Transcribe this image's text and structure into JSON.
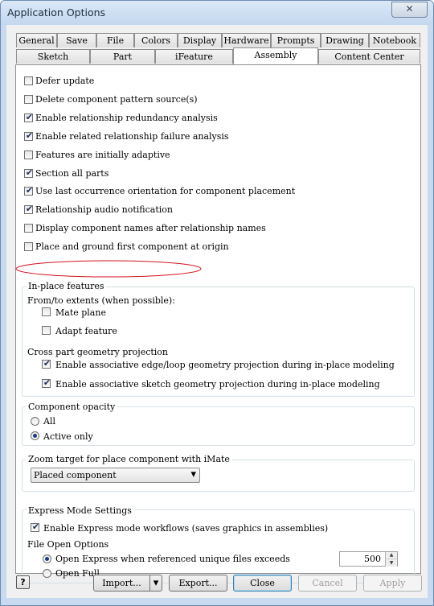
{
  "window": {
    "title": "Application Options",
    "close_glyph": "✕"
  },
  "tabs_row1": [
    "General",
    "Save",
    "File",
    "Colors",
    "Display",
    "Hardware",
    "Prompts",
    "Drawing",
    "Notebook"
  ],
  "tabs_row2": [
    "Sketch",
    "Part",
    "iFeature",
    "Assembly",
    "Content Center"
  ],
  "active_tab": "Assembly",
  "options": [
    {
      "label": "Defer update",
      "checked": false
    },
    {
      "label": "Delete component pattern source(s)",
      "checked": false
    },
    {
      "label": "Enable relationship redundancy analysis",
      "checked": true
    },
    {
      "label": "Enable related relationship failure analysis",
      "checked": true
    },
    {
      "label": "Features are initially adaptive",
      "checked": false
    },
    {
      "label": "Section all parts",
      "checked": true
    },
    {
      "label": "Use last occurrence orientation for component placement",
      "checked": true
    },
    {
      "label": "Relationship audio notification",
      "checked": true
    },
    {
      "label": "Display component names after relationship names",
      "checked": false
    },
    {
      "label": "Place and ground first component at origin",
      "checked": false
    }
  ],
  "inplace": {
    "title": "In-place features",
    "extents_label": "From/to extents (when possible):",
    "mate_plane": {
      "label": "Mate plane",
      "checked": false
    },
    "adapt_feature": {
      "label": "Adapt feature",
      "checked": false
    },
    "cross_label": "Cross part geometry projection",
    "edge_loop": {
      "label": "Enable associative edge/loop geometry projection during in-place modeling",
      "checked": true
    },
    "sketch_geom": {
      "label": "Enable associative sketch geometry projection during in-place modeling",
      "checked": true
    }
  },
  "opacity": {
    "title": "Component opacity",
    "all": "All",
    "active_only": "Active only",
    "selected": "Active only"
  },
  "zoom": {
    "title": "Zoom target for place component with iMate",
    "value": "Placed component"
  },
  "express": {
    "title": "Express Mode Settings",
    "enable": {
      "label": "Enable Express mode workflows (saves graphics in assemblies)",
      "checked": true
    },
    "file_open_label": "File Open Options",
    "open_express": "Open Express when referenced unique files exceeds",
    "threshold": "500",
    "open_full": "Open Full",
    "selected": "Open Express when referenced unique files exceeds"
  },
  "buttons": {
    "help": "?",
    "import": "Import...",
    "export": "Export...",
    "close": "Close",
    "cancel": "Cancel",
    "apply": "Apply"
  },
  "icons": {
    "check": "✔",
    "dropdown": "▾",
    "spin_up": "▲",
    "spin_down": "▼",
    "help": "?"
  },
  "colors": {
    "annotation_circle": "#d2121c",
    "title_bar": "#c7daf0",
    "default_button_border": "#3c7fb1"
  }
}
